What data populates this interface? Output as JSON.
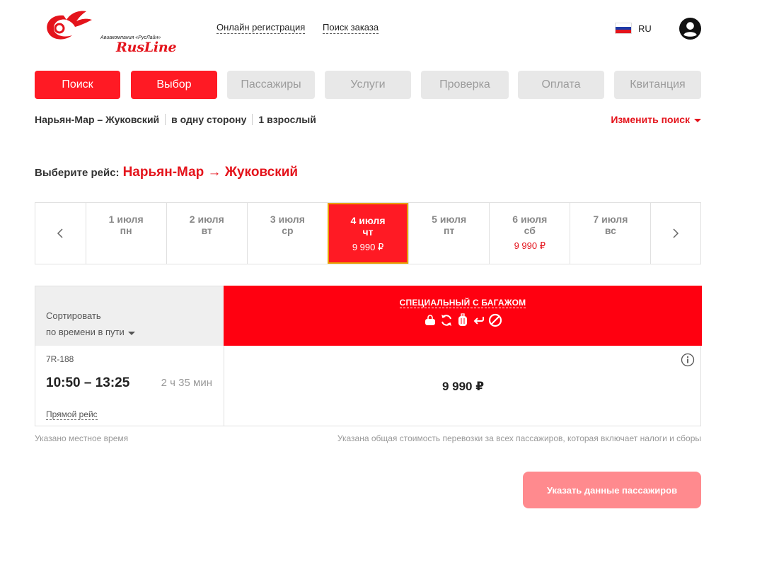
{
  "header": {
    "logo_text": "RusLine",
    "logo_sub": "Авиакомпания «РусЛайн»",
    "links": [
      "Онлайн регистрация",
      "Поиск заказа"
    ],
    "lang": "RU"
  },
  "steps": [
    {
      "label": "Поиск",
      "state": "active"
    },
    {
      "label": "Выбор",
      "state": "active"
    },
    {
      "label": "Пассажиры",
      "state": "inactive"
    },
    {
      "label": "Услуги",
      "state": "inactive"
    },
    {
      "label": "Проверка",
      "state": "inactive"
    },
    {
      "label": "Оплата",
      "state": "inactive"
    },
    {
      "label": "Квитанция",
      "state": "inactive"
    }
  ],
  "summary": {
    "route": "Нарьян-Мар – Жуковский",
    "trip_type": "в одну сторону",
    "passengers": "1 взрослый",
    "change": "Изменить поиск"
  },
  "choose": {
    "label": "Выберите рейс:",
    "route": "Нарьян-Мар →  Жуковский"
  },
  "dates": [
    {
      "date": "1 июля",
      "dow": "пн",
      "price": ""
    },
    {
      "date": "2 июля",
      "dow": "вт",
      "price": ""
    },
    {
      "date": "3 июля",
      "dow": "ср",
      "price": ""
    },
    {
      "date": "4 июля",
      "dow": "чт",
      "price": "9 990 ₽",
      "selected": true
    },
    {
      "date": "5 июля",
      "dow": "пт",
      "price": ""
    },
    {
      "date": "6 июля",
      "dow": "сб",
      "price": "9 990 ₽"
    },
    {
      "date": "7 июля",
      "dow": "вс",
      "price": ""
    }
  ],
  "table": {
    "sort_label": "Сортировать",
    "sort_value": "по времени в пути",
    "fare_name": "СПЕЦИАЛЬНЫЙ С БАГАЖОМ",
    "fare_icons": [
      "bag-icon",
      "exchange-icon",
      "luggage-icon",
      "return-icon",
      "no-refund-icon"
    ],
    "flight": {
      "number": "7R-188",
      "time": "10:50 – 13:25",
      "duration": "2 ч 35 мин",
      "type": "Прямой рейс",
      "price": "9 990 ₽"
    }
  },
  "notes": {
    "left": "Указано местное время",
    "right": "Указана общая стоимость перевозки за всех пассажиров, которая включает налоги и сборы"
  },
  "submit_label": "Указать данные пассажиров",
  "colors": {
    "accent": "#ff1a24",
    "brand": "#e4141c",
    "disabled_button": "#ff8a8e",
    "inactive_step": "#e8e8e8"
  }
}
